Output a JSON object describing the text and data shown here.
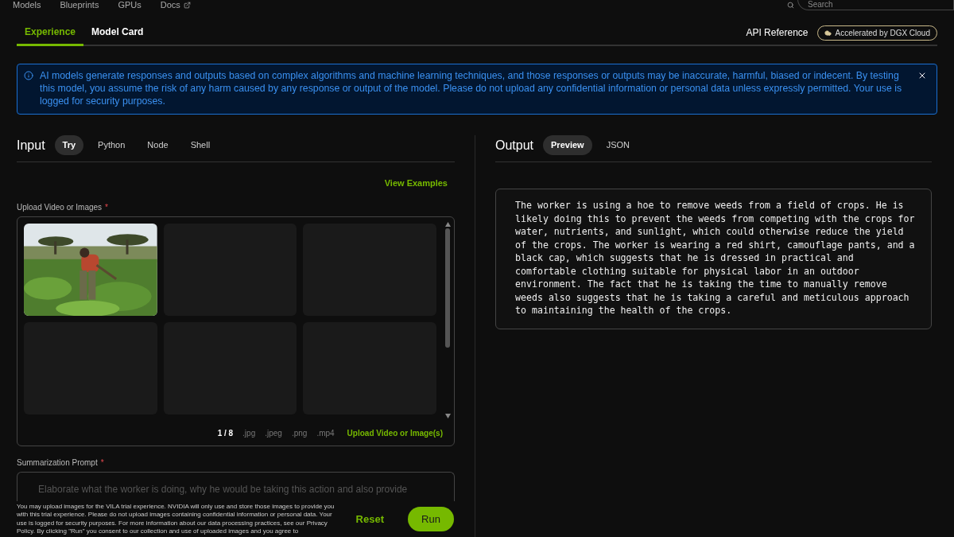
{
  "nav": {
    "items": [
      {
        "label": "Models",
        "external": false
      },
      {
        "label": "Blueprints",
        "external": false
      },
      {
        "label": "GPUs",
        "external": false
      },
      {
        "label": "Docs",
        "external": true
      }
    ],
    "search": {
      "placeholder": "Search"
    }
  },
  "page_tabs": [
    {
      "label": "Experience",
      "selected": true
    },
    {
      "label": "Model Card",
      "selected": false
    }
  ],
  "api_reference": "API Reference",
  "badge": "Accelerated by DGX Cloud",
  "notice": "AI models generate responses and outputs based on complex algorithms and machine learning techniques, and those responses or outputs may be inaccurate, harmful, biased or indecent. By testing this model, you assume the risk of any harm caused by any response or output of the model. Please do not upload any confidential information or personal data unless expressly permitted. Your use is logged for security purposes.",
  "input": {
    "title": "Input",
    "tabs": [
      {
        "label": "Try",
        "selected": true
      },
      {
        "label": "Python",
        "selected": false
      },
      {
        "label": "Node",
        "selected": false
      },
      {
        "label": "Shell",
        "selected": false
      }
    ],
    "view_examples": "View Examples",
    "upload": {
      "label": "Upload Video or Images",
      "required_mark": "*",
      "slots": [
        {
          "kind": "picture"
        },
        {
          "kind": "empty"
        },
        {
          "kind": "empty"
        },
        {
          "kind": "empty"
        },
        {
          "kind": "empty"
        },
        {
          "kind": "empty"
        }
      ],
      "count": "1 / 8",
      "formats": [
        ".jpg",
        ".jpeg",
        ".png",
        ".mp4"
      ],
      "button": "Upload Video or Image(s)"
    },
    "prompt": {
      "label": "Summarization Prompt",
      "required_mark": "*",
      "value": "Elaborate what the worker is doing, why he would be taking this action and also provide"
    },
    "disclaimer": "You may upload images for the VILA trial experience. NVIDIA will only use and store those images to provide you with this trial experience. Please do not upload images containing confidential information or personal data. Your use is logged for security purposes. For more information about our data processing practices, see our Privacy Policy. By clicking \"Run\" you consent to our collection and use of uploaded images and you agree to",
    "reset": "Reset",
    "run": "Run"
  },
  "output": {
    "title": "Output",
    "tabs": [
      {
        "label": "Preview",
        "selected": true
      },
      {
        "label": "JSON",
        "selected": false
      }
    ],
    "text": "The worker is using a hoe to remove weeds from a field of crops. He is likely doing this to prevent the weeds from competing with the crops for water, nutrients, and sunlight, which could otherwise reduce the yield of the crops. The worker is wearing a red shirt, camouflage pants, and a black cap, which suggests that he is dressed in practical and comfortable clothing suitable for physical labor in an outdoor environment. The fact that he is taking the time to manually remove weeds also suggests that he is taking a careful and meticulous approach to maintaining the health of the crops."
  }
}
